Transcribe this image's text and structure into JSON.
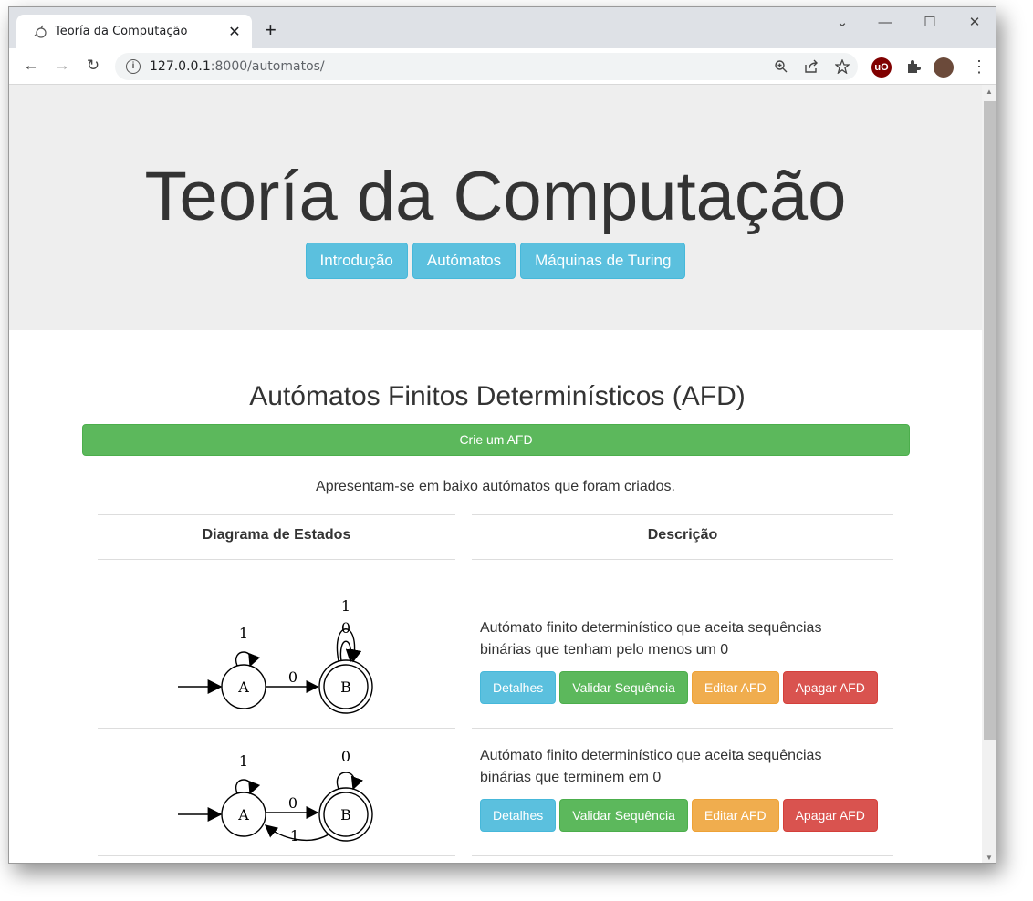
{
  "browser": {
    "tab_title": "Teoría da Computação",
    "tab_close": "✕",
    "new_tab": "+",
    "url_host": "127.0.0.1",
    "url_rest": ":8000/automatos/",
    "minimize": "—",
    "maximize": "☐",
    "close": "✕",
    "chevron": "⌄",
    "ext_ublock": "uO"
  },
  "header": {
    "title": "Teoría da Computação",
    "nav": [
      {
        "label": "Introdução"
      },
      {
        "label": "Autómatos"
      },
      {
        "label": "Máquinas de Turing"
      }
    ]
  },
  "main": {
    "section_title": "Autómatos Finitos Determinísticos (AFD)",
    "create_button": "Crie um AFD",
    "lead": "Apresentam-se em baixo autómatos que foram criados.",
    "table": {
      "headers": [
        "Diagrama de Estados",
        "Descrição"
      ],
      "rows": [
        {
          "diagram": {
            "states": [
              "A",
              "B"
            ],
            "labels": [
              "1",
              "0",
              "1",
              "0"
            ]
          },
          "description": "Autómato finito determinístico que aceita sequências binárias que tenham pelo menos um 0",
          "buttons": [
            "Detalhes",
            "Validar Sequência",
            "Editar AFD",
            "Apagar AFD"
          ]
        },
        {
          "diagram": {
            "states": [
              "A",
              "B"
            ],
            "labels": [
              "1",
              "0",
              "0",
              "1"
            ]
          },
          "description": "Autómato finito determinístico que aceita sequências binárias que terminem em 0",
          "buttons": [
            "Detalhes",
            "Validar Sequência",
            "Editar AFD",
            "Apagar AFD"
          ]
        }
      ]
    }
  },
  "colors": {
    "info": "#5bc0de",
    "success": "#5cb85c",
    "warning": "#f0ad4e",
    "danger": "#d9534f",
    "jumbotron": "#eeeeee"
  }
}
